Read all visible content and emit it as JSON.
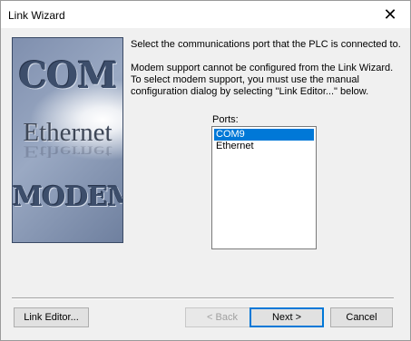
{
  "window": {
    "title": "Link Wizard",
    "close_icon": "close-icon",
    "close_glyph": "✕"
  },
  "side_image": {
    "words": [
      "COM",
      "Ethernet",
      "MODEM"
    ]
  },
  "content": {
    "instruction": "Select the communications port that the PLC is connected to.",
    "modem_note_line1": "Modem support cannot be configured from the Link Wizard.",
    "modem_note_line2": "To select modem support, you must use the manual",
    "modem_note_line3": "configuration dialog by selecting \"Link Editor...\" below."
  },
  "ports": {
    "label": "Ports:",
    "items": [
      {
        "label": "COM9",
        "selected": true
      },
      {
        "label": "Ethernet",
        "selected": false
      }
    ]
  },
  "buttons": {
    "link_editor": "Link Editor...",
    "back": "< Back",
    "next": "Next >",
    "cancel": "Cancel"
  },
  "colors": {
    "selection": "#0078d7",
    "dialog_bg": "#f0f0f0"
  }
}
